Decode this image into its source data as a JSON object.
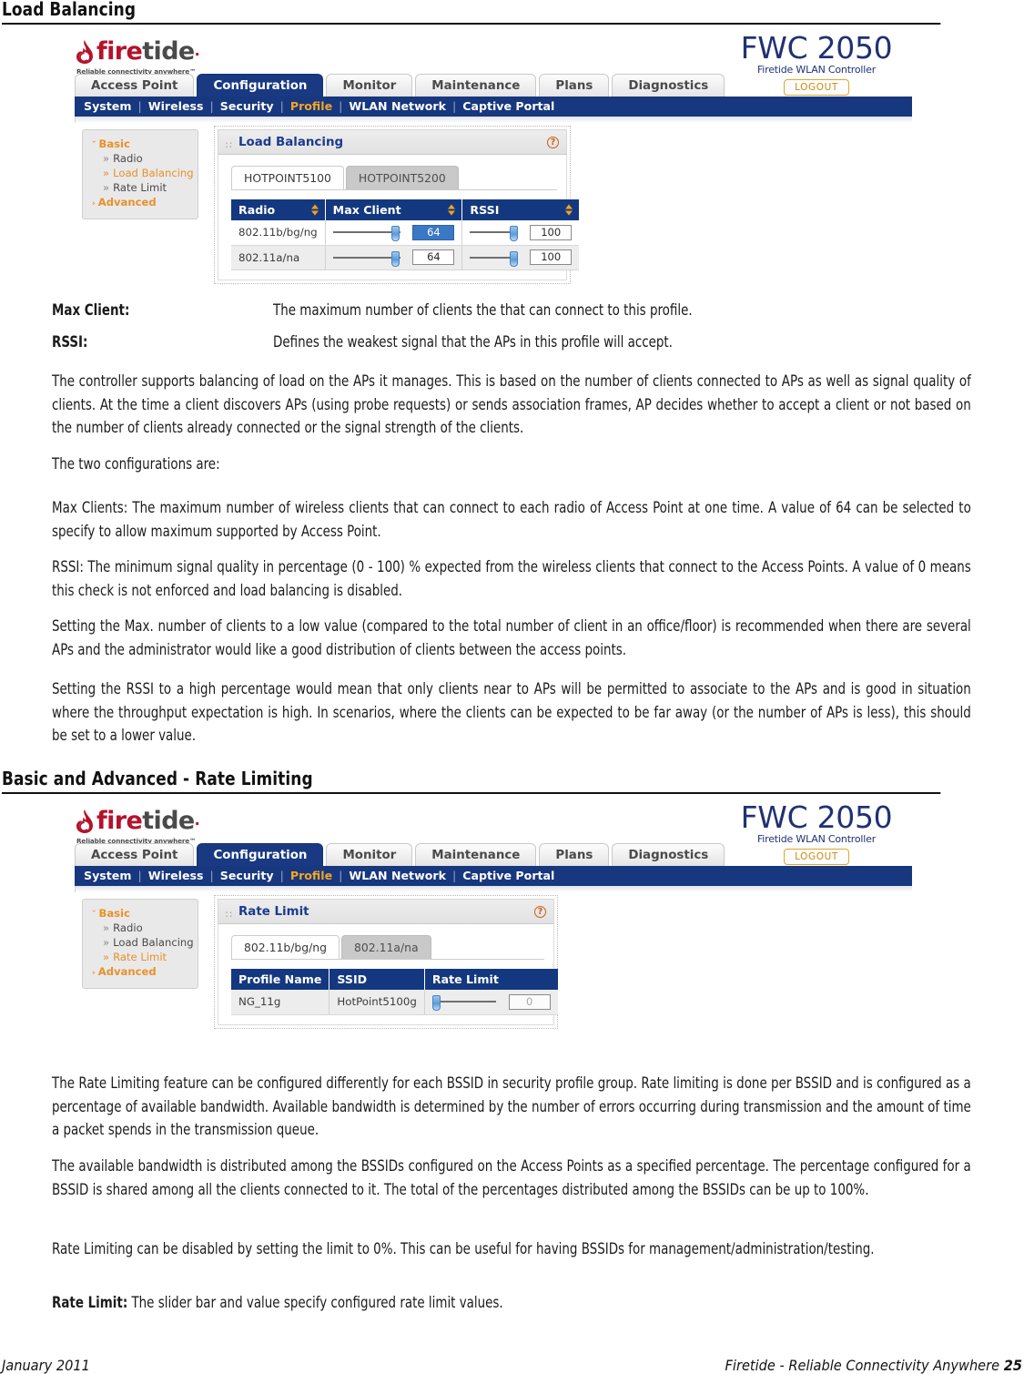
{
  "sections": [
    {
      "heading": "Load Balancing"
    },
    {
      "heading": "Basic and Advanced - Rate Limiting"
    }
  ],
  "definitions": [
    {
      "term": "Max Client:",
      "desc": "The maximum number of clients the that can connect to this profile."
    },
    {
      "term": "RSSI:",
      "desc": "Defines the weakest signal that the APs in this profile will accept."
    }
  ],
  "paragraphs": {
    "p1": "The controller supports balancing of load on the APs it manages. This is based on the number of clients connected to APs as well as signal quality of clients. At the time a client discovers APs (using probe requests) or sends association frames, AP decides whether to accept a client or not based on the number of clients already connected or the signal strength of the clients.",
    "p2": "The two configurations are:",
    "p3": "Max Clients: The maximum number of wireless clients that can connect to each radio of Access Point at one time. A value of 64 can be selected to specify to allow maximum supported by Access Point.",
    "p4": "RSSI: The minimum signal quality in percentage (0 - 100) % expected from the wireless clients that connect to the Access Points. A value of 0 means this check is not enforced and load balancing is disabled.",
    "p5": "Setting the Max. number of clients to a low value (compared to the total number of client in an office/floor) is recommended when there are several APs and the administrator would like a good distribution of clients between the access points.",
    "p6": "Setting the RSSI to a high percentage would mean that only clients near to APs will be permitted to associate to the APs and is good in situation where the throughput expectation is high. In scenarios, where the clients can be expected to be far away (or the number of APs is less), this should be set to a lower value.",
    "p7": "The Rate Limiting feature can be configured differently for each BSSID in security profile group. Rate limiting is done per BSSID and is configured as a percentage of available bandwidth. Available bandwidth is determined by the number of errors occurring during transmission and the amount of time a packet spends in the transmission queue.",
    "p8": "The available bandwidth is distributed among the BSSIDs configured on the Access Points as a specified percentage. The percentage configured for a BSSID is shared among all the clients connected to it. The total of the percentages distributed among the BSSIDs can be up to 100%.",
    "p9": "Rate Limiting can be disabled by setting the limit to 0%. This can be useful for having BSSIDs for management/administration/testing.",
    "p10_bold": "Rate Limit:",
    "p10_rest": " The slider bar and value specify configured rate limit values."
  },
  "footer": {
    "date": "January 2011",
    "company": "Firetide - Reliable Connectivity Anywhere",
    "page": "25"
  },
  "app": {
    "logo": {
      "word_fire": "fire",
      "word_tide": "tide",
      "registered": "·",
      "tagline": "Reliable connectivity anywhere™"
    },
    "product": {
      "model": "FWC 2050",
      "subtitle": "Firetide WLAN Controller",
      "logout": "LOGOUT"
    },
    "primary_tabs": [
      {
        "label": "Access Point",
        "active": false
      },
      {
        "label": "Configuration",
        "active": true
      },
      {
        "label": "Monitor",
        "active": false
      },
      {
        "label": "Maintenance",
        "active": false
      },
      {
        "label": "Plans",
        "active": false
      },
      {
        "label": "Diagnostics",
        "active": false
      }
    ],
    "sub_nav": [
      {
        "label": "System",
        "active": false
      },
      {
        "label": "Wireless",
        "active": false
      },
      {
        "label": "Security",
        "active": false
      },
      {
        "label": "Profile",
        "active": true
      },
      {
        "label": "WLAN Network",
        "active": false
      },
      {
        "label": "Captive Portal",
        "active": false
      }
    ],
    "tree": {
      "basic": "Basic",
      "radio": "Radio",
      "load_balancing": "Load Balancing",
      "rate_limit": "Rate Limit",
      "advanced": "Advanced",
      "caret": "ˇ",
      "caret_collapsed": "›",
      "bullet": "»"
    },
    "colors": {
      "nav_blue": "#17377e",
      "table_header_blue": "#14387f",
      "accent_orange": "#e8912a",
      "sort_arrow": "#f0a323",
      "brand_red": "#b4122b",
      "product_blue": "#1f3274",
      "logout_border": "#e0a62e"
    }
  },
  "screen1": {
    "panel_title": "Load Balancing",
    "help_label": "?",
    "grip": "∷",
    "tabs": [
      {
        "label": "HOTPOINT5100",
        "active": true
      },
      {
        "label": "HOTPOINT5200",
        "active": false
      }
    ],
    "columns": [
      "Radio",
      "Max Client",
      "RSSI"
    ],
    "rows": [
      {
        "radio": "802.11b/bg/ng",
        "max_client": "64",
        "max_client_selected": true,
        "rssi": "100"
      },
      {
        "radio": "802.11a/na",
        "max_client": "64",
        "max_client_selected": false,
        "rssi": "100"
      }
    ]
  },
  "screen2": {
    "panel_title": "Rate Limit",
    "help_label": "?",
    "grip": "∷",
    "tabs": [
      {
        "label": "802.11b/bg/ng",
        "active": true
      },
      {
        "label": "802.11a/na",
        "active": false
      }
    ],
    "columns": [
      "Profile Name",
      "SSID",
      "Rate Limit"
    ],
    "rows": [
      {
        "profile_name": "NG_11g",
        "ssid": "HotPoint5100g",
        "rate_limit": "0"
      }
    ]
  }
}
